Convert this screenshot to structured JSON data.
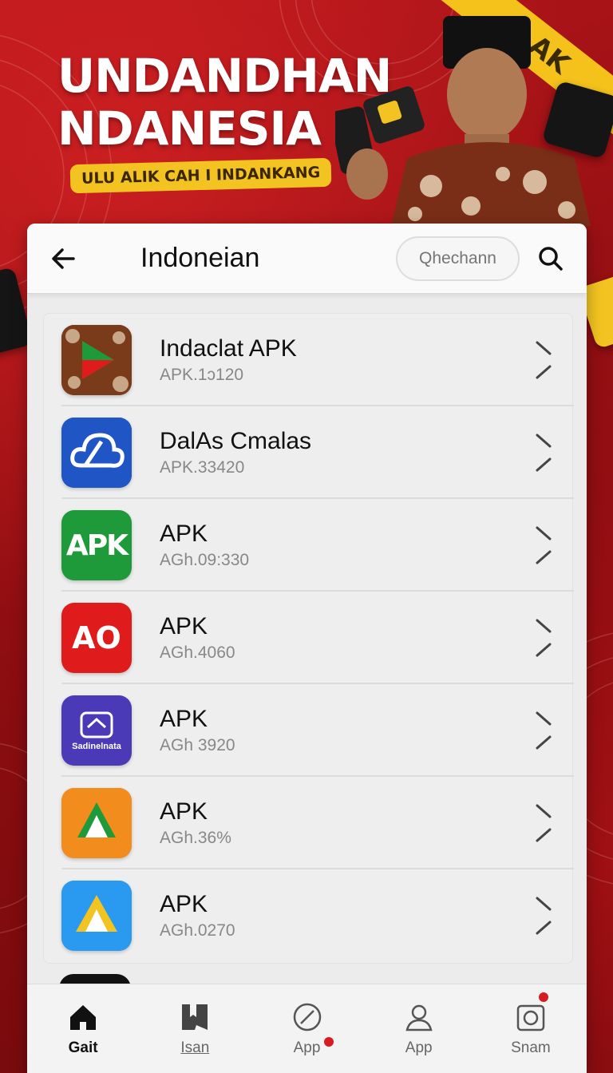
{
  "hero": {
    "title_line1": "UNDANDHAN",
    "title_line2": "NDANESIA",
    "subtitle": "ULU ALIK CAH I INDANKANG",
    "stripe_text": "AK"
  },
  "header": {
    "title": "Indoneian",
    "search_placeholder": "Qhechann"
  },
  "apps": [
    {
      "title": "Indaclat APK",
      "subtitle": "APK.1ɔ120",
      "icon": "batik-play-icon",
      "color": "#7a3b1a"
    },
    {
      "title": "DalAs Cmalas",
      "subtitle": "APK.33420",
      "icon": "cloud-icon",
      "color": "#1f55c4"
    },
    {
      "title": "APK",
      "subtitle": "AGh.09:330",
      "icon": "apk-text-icon",
      "color": "#1f9a3a",
      "icon_text": "APK"
    },
    {
      "title": "APK",
      "subtitle": "AGh.4060",
      "icon": "ao-chat-icon",
      "color": "#e01b1b",
      "icon_text": "AO"
    },
    {
      "title": "APK",
      "subtitle": "AGh 3920",
      "icon": "mask-icon",
      "color": "#4b3ab8",
      "icon_text": "Sadinelnata"
    },
    {
      "title": "APK",
      "subtitle": "AGh.36%",
      "icon": "drive-icon",
      "color": "#f28c1d"
    },
    {
      "title": "APK",
      "subtitle": "AGh.0270",
      "icon": "drive-blue-icon",
      "color": "#2a9af0"
    }
  ],
  "nav": [
    {
      "label": "Gait",
      "icon": "home-icon",
      "active": true
    },
    {
      "label": "Isan",
      "icon": "book-icon",
      "active": false
    },
    {
      "label": "App",
      "icon": "compass-icon",
      "active": false
    },
    {
      "label": "App",
      "icon": "person-icon",
      "active": false
    },
    {
      "label": "Snam",
      "icon": "camera-icon",
      "active": false
    }
  ],
  "colors": {
    "accent_red": "#d81b23",
    "brand_yellow": "#f3c421",
    "background_red": "#a31217"
  }
}
